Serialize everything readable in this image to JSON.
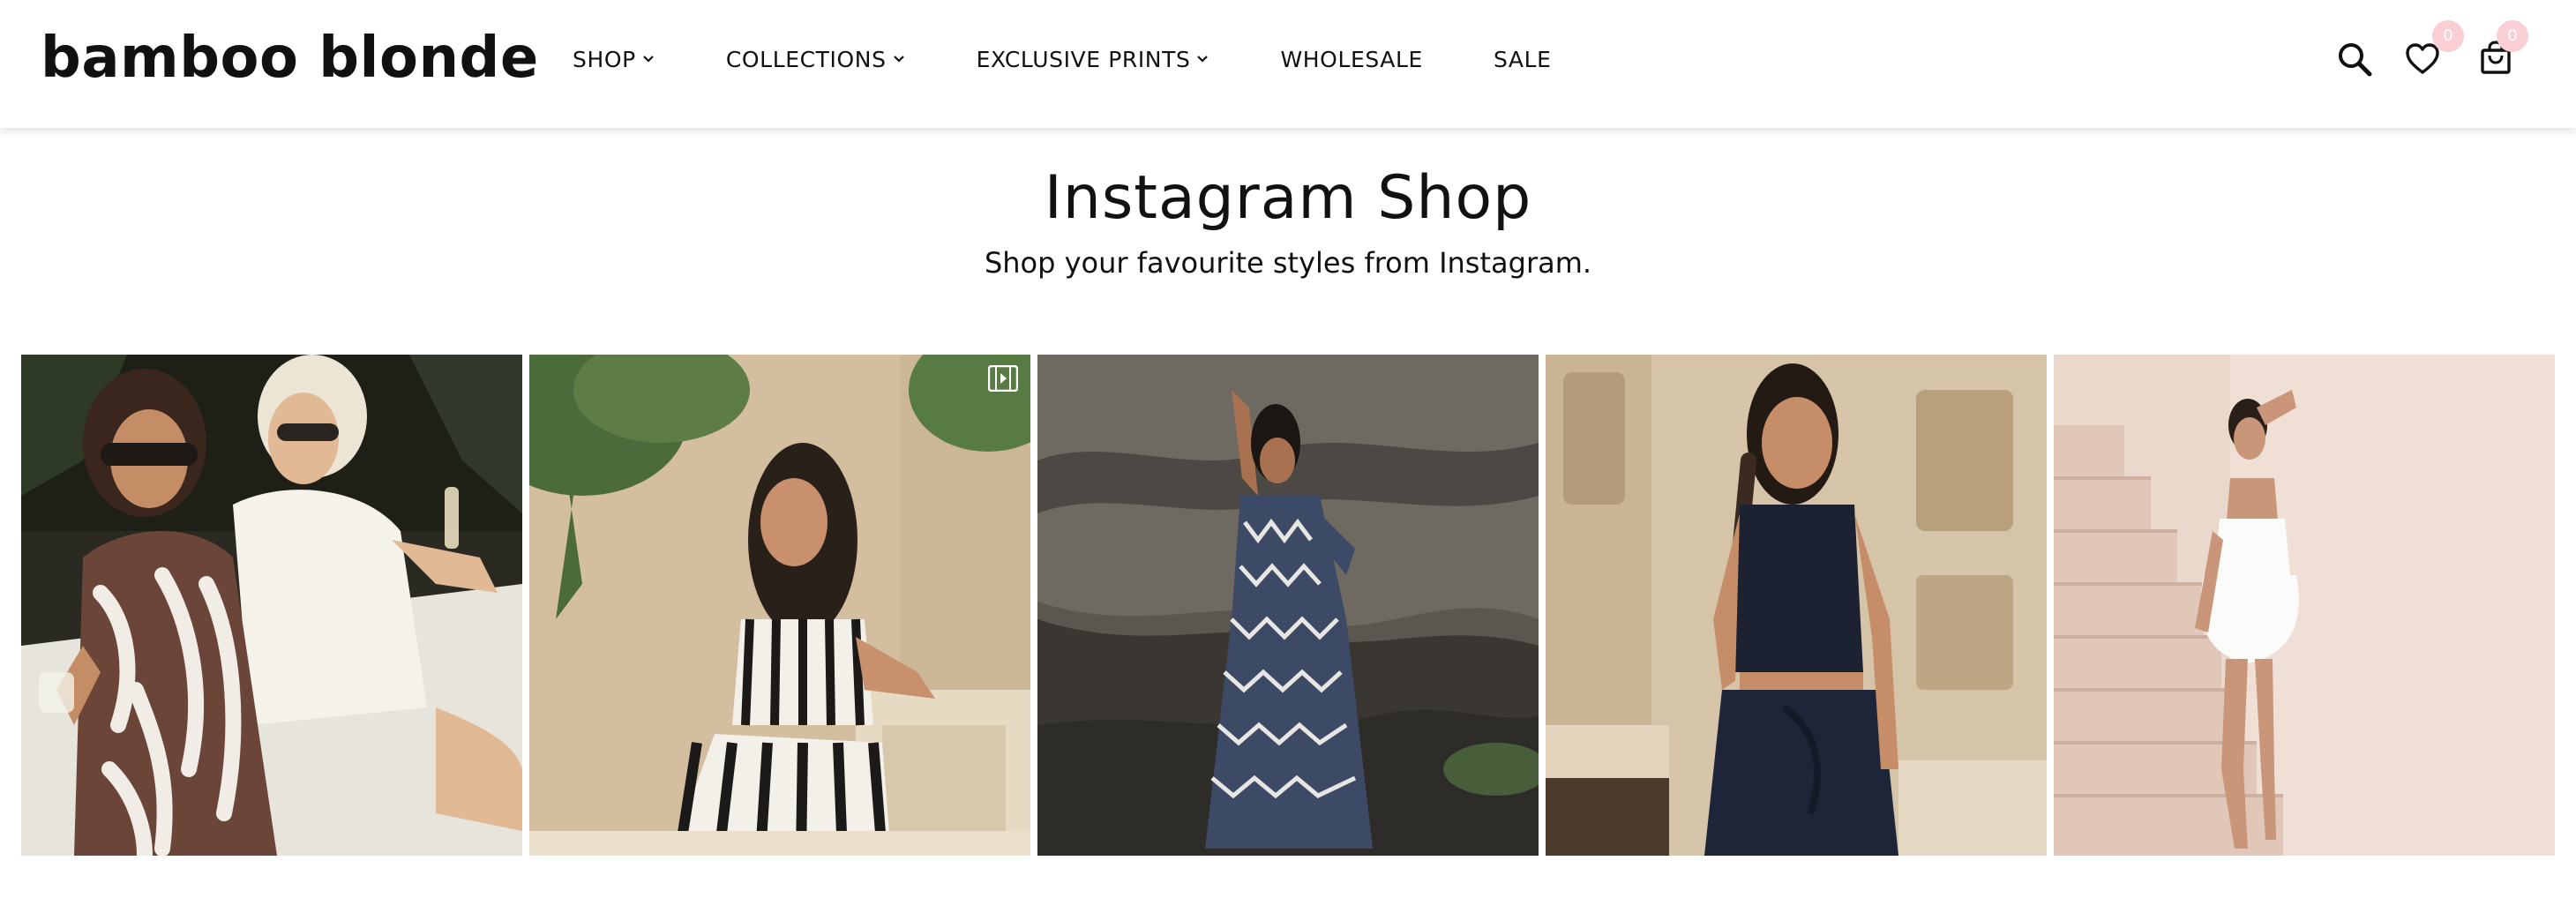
{
  "brand": {
    "logo": "bamboo blonde"
  },
  "nav": [
    {
      "label": "SHOP",
      "dropdown": true
    },
    {
      "label": "COLLECTIONS",
      "dropdown": true
    },
    {
      "label": "EXCLUSIVE PRINTS",
      "dropdown": true
    },
    {
      "label": "WHOLESALE",
      "dropdown": false
    },
    {
      "label": "SALE",
      "dropdown": false
    }
  ],
  "header_icons": {
    "search": "search-icon",
    "wishlist": "heart-icon",
    "wishlist_count": "0",
    "cart": "shopping-bag-icon",
    "cart_count": "0"
  },
  "page": {
    "title": "Instagram Shop",
    "subtitle": "Shop your favourite styles from Instagram."
  },
  "gallery": {
    "tiles": [
      {
        "name": "instagram-post-1",
        "subject": "two women in sunglasses, brown leaf print halter dress",
        "reel": false
      },
      {
        "name": "instagram-post-2",
        "subject": "woman in black and white striped set",
        "reel": true
      },
      {
        "name": "instagram-post-3",
        "subject": "woman in navy chevron maxi dress by rock",
        "reel": false
      },
      {
        "name": "instagram-post-4",
        "subject": "woman in navy linen crop top and skirt",
        "reel": false
      },
      {
        "name": "instagram-post-5",
        "subject": "woman in white strapless mini dress on stairs",
        "reel": false
      }
    ]
  },
  "colors": {
    "text": "#111111",
    "badge": "#f9cfd5",
    "background": "#ffffff"
  }
}
